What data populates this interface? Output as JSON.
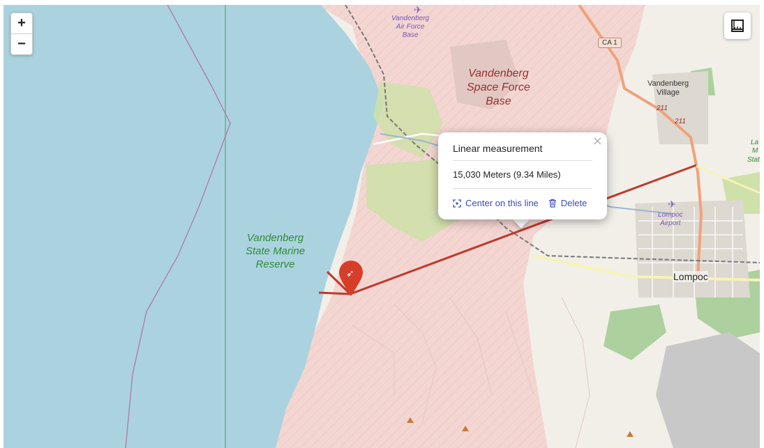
{
  "map": {
    "controls": {
      "zoom_in_label": "+",
      "zoom_out_label": "−",
      "measure_icon": "ruler-icon"
    },
    "popup": {
      "title": "Linear measurement",
      "result": "15,030 Meters (9.34 Miles)",
      "center_label": "Center on this line",
      "delete_label": "Delete",
      "close_label": "×"
    },
    "labels": {
      "air_force_base": [
        "Vandenberg",
        "Air Force",
        "Base"
      ],
      "space_force_base": [
        "Vandenberg",
        "Space Force",
        "Base"
      ],
      "marine_reserve": [
        "Vandenberg",
        "State Marine",
        "Reserve"
      ],
      "village": [
        "Vandenberg",
        "Village"
      ],
      "lompoc_airport": [
        "Lompoc",
        "Airport"
      ],
      "lompoc": "Lompoc",
      "shield_ca1": "CA 1",
      "route_211_a": "211",
      "route_211_b": "211",
      "edge_a": "La",
      "edge_b": "M",
      "edge_c": "Stat"
    },
    "marker_icon": "rocket-icon",
    "colors": {
      "water": "#aad3df",
      "military": "#f3d6d2",
      "land": "#f2efe9",
      "measure_line": "#c0392b",
      "marker": "#d63e2a",
      "link": "#3b4bb5",
      "park": "#add19e"
    }
  }
}
